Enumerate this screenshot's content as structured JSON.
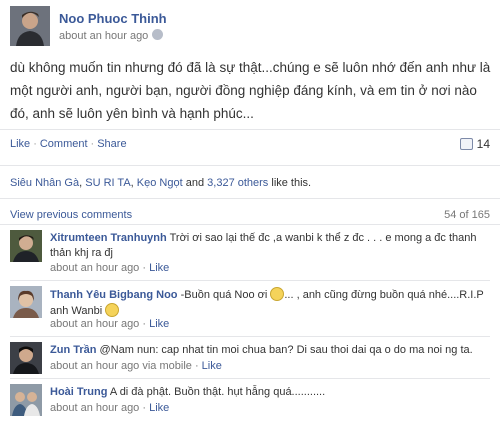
{
  "post": {
    "author": "Noo Phuoc Thinh",
    "time": "about an hour ago",
    "body": "dù không muốn tin nhưng đó đã là sự thật...chúng e sẽ luôn nhớ đến anh như là một người anh, người bạn, người đồng nghiệp đáng kính, và em tin ở nơi nào đó, anh sẽ luôn yên bình và hạnh phúc..."
  },
  "actions": {
    "like": "Like",
    "comment": "Comment",
    "share": "Share",
    "share_count": "14"
  },
  "likes": {
    "name1": "Siêu Nhân Gà",
    "name2": "SU RI TA",
    "name3": "Kẹo Ngọt",
    "others": "3,327 others",
    "and": "and",
    "suffix": "like this."
  },
  "comments_nav": {
    "view_previous": "View previous comments",
    "count": "54 of 165"
  },
  "comments": [
    {
      "author": "Xitrumteen Tranhuynh",
      "text": "Trời ơi sao lại thế đc ,a wanbi k thể z đc . . . e mong a đc thanh thản khj ra đj",
      "time": "about an hour ago",
      "like": "Like"
    },
    {
      "author": "Thanh Yêu Bigbang Noo",
      "text1": "-Buồn quá Noo ơi",
      "text2": "... , anh cũng đừng buồn quá nhé....R.I.P anh Wanbi",
      "time": "about an hour ago",
      "like": "Like"
    },
    {
      "author": "Zun Trần",
      "text": "@Nam nun: cap nhat tin moi chua ban? Di sau thoi dai qa o do ma noi ng ta.",
      "time": "about an hour ago via mobile",
      "like": "Like"
    },
    {
      "author": "Hoài Trung",
      "text": "A di đà phật. Buồn thật. hụt hẫng quá...........",
      "time": "about an hour ago",
      "like": "Like"
    }
  ]
}
